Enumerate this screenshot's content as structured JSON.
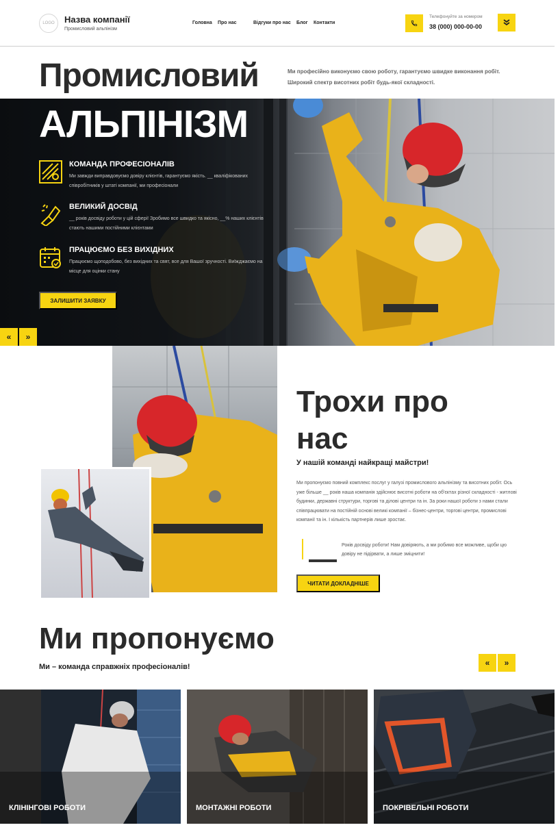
{
  "header": {
    "logo_text": "LOGO",
    "company_name": "Назва компанії",
    "company_sub": "Промисловий альпінізм",
    "nav": [
      "Головна",
      "Про нас",
      "Відгуки про нас",
      "Блог",
      "Контакти"
    ],
    "phone_caption": "Телефонуйте за номером",
    "phone_number": "38 (000) 000-00-00",
    "icons": {
      "phone": "phone-icon",
      "menu": "double-chevron-down-icon"
    }
  },
  "hero": {
    "title_line1": "Промисловий",
    "title_line2": "АЛЬПІНІЗМ",
    "description": "Ми професійно виконуємо свою роботу, гарантуємо швидке виконання робіт. Широкий спектр висотних робіт будь-якої складності.",
    "features": [
      {
        "icon": "team-icon",
        "title": "КОМАНДА ПРОФЕСІОНАЛІВ",
        "text": "Ми завжди виправдовуємо довіру клієнтів, гарантуємо якість. __ кваліфікованих співробітників у штаті компанії, ми професіонали"
      },
      {
        "icon": "experience-icon",
        "title": "ВЕЛИКИЙ ДОСВІД",
        "text": "__ років досвіду роботи у цій сфері! Зробимо все швидко та якісно, __% наших клієнтів стають нашими постійними клієнтами"
      },
      {
        "icon": "calendar-icon",
        "title": "ПРАЦЮЄМО БЕЗ ВИХІДНИХ",
        "text": "Працюємо щоподобово, без вихідних та свят, все для Вашої зручності. Виїжджаємо на місце для оцінки стану"
      }
    ],
    "cta": "ЗАЛИШИТИ ЗАЯВКУ",
    "prev": "«",
    "next": "»"
  },
  "about": {
    "title": "Трохи про нас",
    "subtitle": "У нашій команді найкращі майстри!",
    "text": "Ми пропонуємо повний комплекс послуг у галузі промислового альпінізму та висотних робіт. Ось уже більше __ років наша компанія здійснює висотні роботи на об'єктах різної складності - житлові будинки, державні структури, торгові та ділові центри та ін. За роки нашої роботи з нами стали співпрацювати на постійній основі великі компанії – бізнес-центри, торгові центри, промислові компанії та ін. І кількість партнерів лише зростає.",
    "quote": "Років досвіду роботи! Нам довіряють, а ми робимо все можливе, щоби цю довіру не підірвати, а лише зміцнити!",
    "cta": "ЧИТАТИ ДОКЛАДНІШЕ"
  },
  "services": {
    "title": "Ми пропонуємо",
    "subtitle": "Ми – команда справжніх професіоналів!",
    "prev": "«",
    "next": "»",
    "cards": [
      {
        "label": "КЛІНІНГОВІ РОБОТИ"
      },
      {
        "label": "МОНТАЖНІ РОБОТИ"
      },
      {
        "label": "ПОКРІВЕЛЬНІ РОБОТИ"
      }
    ]
  },
  "colors": {
    "accent": "#f7d411",
    "text_dark": "#2b2b2b"
  }
}
